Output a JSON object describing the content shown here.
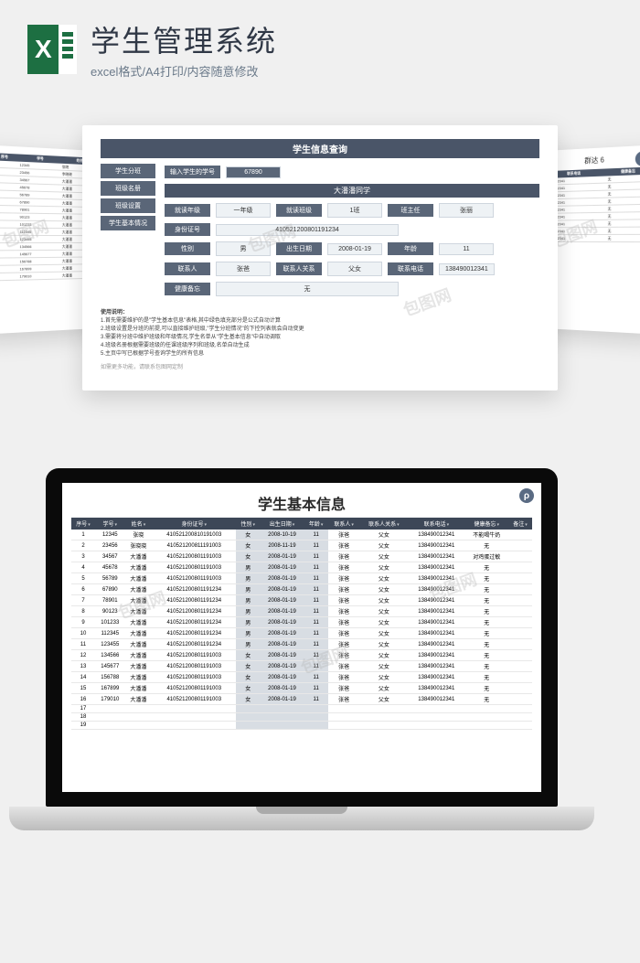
{
  "header": {
    "title": "学生管理系统",
    "subtitle": "excel格式/A4打印/内容随意修改",
    "icon_letter": "X"
  },
  "center_doc": {
    "title": "学生信息查询",
    "sidebar": [
      "学生分班",
      "班级名册",
      "班级设置",
      "学生基本情况"
    ],
    "input_label": "输入学生的学号",
    "input_value": "67890",
    "student_name": "大潘潘同学",
    "grade_label": "就读年级",
    "grade_value": "一年级",
    "class_label": "就读班级",
    "class_value": "1班",
    "teacher_label": "班主任",
    "teacher_value": "张丽",
    "id_label": "身份证号",
    "id_value": "410521200801191234",
    "gender_label": "性别",
    "gender_value": "男",
    "birth_label": "出生日期",
    "birth_value": "2008-01-19",
    "age_label": "年龄",
    "age_value": "11",
    "contact_label": "联系人",
    "contact_value": "张爸",
    "relation_label": "联系人关系",
    "relation_value": "父女",
    "phone_label": "联系电话",
    "phone_value": "138490012341",
    "health_label": "健康备忘",
    "health_value": "无",
    "notes_title": "使用说明：",
    "notes": [
      "1.首先需要维护的是\"学生基本信息\"表格,其中绿色填充部分是公式自动计算",
      "2.班级设置是分班的前提,可以直接维护班级,\"学生分班情况\"的下控列表就会自动变更",
      "3.需要将分班中维护班级和年级情况,学生名单从\"学生基本信息\"中自动调取",
      "4.班级名册根据需要班级的任课班级序列和班级,名单自动生成",
      "5.主页中写已根据学号查询学生的所有信息"
    ],
    "notes_footer": "如需更多功能，请联系包图网定制"
  },
  "right_doc": {
    "header1": "联系电话",
    "header2": "健康备忘",
    "group": "群达",
    "count": "6",
    "rows": [
      {
        "phone": "138490012341",
        "h": "无"
      },
      {
        "phone": "138490012341",
        "h": "无"
      },
      {
        "phone": "138490012341",
        "h": "无"
      },
      {
        "phone": "138490012341",
        "h": "无"
      },
      {
        "phone": "138490012341",
        "h": "无"
      },
      {
        "phone": "138490012341",
        "h": "无"
      },
      {
        "phone": "138490012341",
        "h": "无"
      },
      {
        "phone": "138490012341",
        "h": "无"
      },
      {
        "phone": "138490012341",
        "h": "无"
      }
    ]
  },
  "left_doc": {
    "headers": [
      "序号",
      "学号",
      "姓名"
    ],
    "rows": [
      {
        "i": "1",
        "id": "12345",
        "n": "张晓"
      },
      {
        "i": "2",
        "id": "23456",
        "n": "李晓晓"
      },
      {
        "i": "3",
        "id": "34567",
        "n": "大潘潘"
      },
      {
        "i": "4",
        "id": "45678",
        "n": "大潘潘"
      },
      {
        "i": "5",
        "id": "56789",
        "n": "大潘潘"
      },
      {
        "i": "6",
        "id": "67890",
        "n": "大潘潘"
      },
      {
        "i": "7",
        "id": "78901",
        "n": "大潘潘"
      },
      {
        "i": "8",
        "id": "90123",
        "n": "大潘潘"
      },
      {
        "i": "9",
        "id": "101233",
        "n": "大潘潘"
      },
      {
        "i": "10",
        "id": "112345",
        "n": "大潘潘"
      },
      {
        "i": "11",
        "id": "123455",
        "n": "大潘潘"
      },
      {
        "i": "12",
        "id": "134566",
        "n": "大潘潘"
      },
      {
        "i": "13",
        "id": "145677",
        "n": "大潘潘"
      },
      {
        "i": "14",
        "id": "156788",
        "n": "大潘潘"
      },
      {
        "i": "15",
        "id": "167899",
        "n": "大潘潘"
      },
      {
        "i": "16",
        "id": "179010",
        "n": "大潘潘"
      }
    ]
  },
  "screen": {
    "title": "学生基本信息",
    "headers": [
      "序号",
      "学号",
      "姓名",
      "身份证号",
      "性别",
      "出生日期",
      "年龄",
      "联系人",
      "联系人关系",
      "联系电话",
      "健康备忘",
      "备注"
    ],
    "rows": [
      {
        "i": "1",
        "id": "12345",
        "n": "张晓",
        "card": "410521200810191003",
        "g": "女",
        "b": "2008-10-19",
        "a": "11",
        "c": "张爸",
        "r": "父女",
        "p": "138490012341",
        "h": "不能喝牛奶",
        "note": ""
      },
      {
        "i": "2",
        "id": "23456",
        "n": "张晓晓",
        "card": "410521200811191003",
        "g": "女",
        "b": "2008-11-19",
        "a": "11",
        "c": "张爸",
        "r": "父女",
        "p": "138490012341",
        "h": "无",
        "note": ""
      },
      {
        "i": "3",
        "id": "34567",
        "n": "大潘潘",
        "card": "410521200801191003",
        "g": "女",
        "b": "2008-01-19",
        "a": "11",
        "c": "张爸",
        "r": "父女",
        "p": "138490012341",
        "h": "对鸡蛋过敏",
        "note": ""
      },
      {
        "i": "4",
        "id": "45678",
        "n": "大潘潘",
        "card": "410521200801191003",
        "g": "男",
        "b": "2008-01-19",
        "a": "11",
        "c": "张爸",
        "r": "父女",
        "p": "138490012341",
        "h": "无",
        "note": ""
      },
      {
        "i": "5",
        "id": "56789",
        "n": "大潘潘",
        "card": "410521200801191003",
        "g": "男",
        "b": "2008-01-19",
        "a": "11",
        "c": "张爸",
        "r": "父女",
        "p": "138490012341",
        "h": "无",
        "note": ""
      },
      {
        "i": "6",
        "id": "67890",
        "n": "大潘潘",
        "card": "410521200801191234",
        "g": "男",
        "b": "2008-01-19",
        "a": "11",
        "c": "张爸",
        "r": "父女",
        "p": "138490012341",
        "h": "无",
        "note": ""
      },
      {
        "i": "7",
        "id": "78901",
        "n": "大潘潘",
        "card": "410521200801191234",
        "g": "男",
        "b": "2008-01-19",
        "a": "11",
        "c": "张爸",
        "r": "父女",
        "p": "138490012341",
        "h": "无",
        "note": ""
      },
      {
        "i": "8",
        "id": "90123",
        "n": "大潘潘",
        "card": "410521200801191234",
        "g": "男",
        "b": "2008-01-19",
        "a": "11",
        "c": "张爸",
        "r": "父女",
        "p": "138490012341",
        "h": "无",
        "note": ""
      },
      {
        "i": "9",
        "id": "101233",
        "n": "大潘潘",
        "card": "410521200801191234",
        "g": "男",
        "b": "2008-01-19",
        "a": "11",
        "c": "张爸",
        "r": "父女",
        "p": "138490012341",
        "h": "无",
        "note": ""
      },
      {
        "i": "10",
        "id": "112345",
        "n": "大潘潘",
        "card": "410521200801191234",
        "g": "男",
        "b": "2008-01-19",
        "a": "11",
        "c": "张爸",
        "r": "父女",
        "p": "138490012341",
        "h": "无",
        "note": ""
      },
      {
        "i": "11",
        "id": "123455",
        "n": "大潘潘",
        "card": "410521200801191234",
        "g": "男",
        "b": "2008-01-19",
        "a": "11",
        "c": "张爸",
        "r": "父女",
        "p": "138490012341",
        "h": "无",
        "note": ""
      },
      {
        "i": "12",
        "id": "134566",
        "n": "大潘潘",
        "card": "410521200801191003",
        "g": "女",
        "b": "2008-01-19",
        "a": "11",
        "c": "张爸",
        "r": "父女",
        "p": "138490012341",
        "h": "无",
        "note": ""
      },
      {
        "i": "13",
        "id": "145677",
        "n": "大潘潘",
        "card": "410521200801191003",
        "g": "女",
        "b": "2008-01-19",
        "a": "11",
        "c": "张爸",
        "r": "父女",
        "p": "138490012341",
        "h": "无",
        "note": ""
      },
      {
        "i": "14",
        "id": "156788",
        "n": "大潘潘",
        "card": "410521200801191003",
        "g": "女",
        "b": "2008-01-19",
        "a": "11",
        "c": "张爸",
        "r": "父女",
        "p": "138490012341",
        "h": "无",
        "note": ""
      },
      {
        "i": "15",
        "id": "167899",
        "n": "大潘潘",
        "card": "410521200801191003",
        "g": "女",
        "b": "2008-01-19",
        "a": "11",
        "c": "张爸",
        "r": "父女",
        "p": "138490012341",
        "h": "无",
        "note": ""
      },
      {
        "i": "16",
        "id": "179010",
        "n": "大潘潘",
        "card": "410521200801191003",
        "g": "女",
        "b": "2008-01-19",
        "a": "11",
        "c": "张爸",
        "r": "父女",
        "p": "138490012341",
        "h": "无",
        "note": ""
      },
      {
        "i": "17",
        "id": "",
        "n": "",
        "card": "",
        "g": "",
        "b": "",
        "a": "",
        "c": "",
        "r": "",
        "p": "",
        "h": "",
        "note": ""
      },
      {
        "i": "18",
        "id": "",
        "n": "",
        "card": "",
        "g": "",
        "b": "",
        "a": "",
        "c": "",
        "r": "",
        "p": "",
        "h": "",
        "note": ""
      },
      {
        "i": "19",
        "id": "",
        "n": "",
        "card": "",
        "g": "",
        "b": "",
        "a": "",
        "c": "",
        "r": "",
        "p": "",
        "h": "",
        "note": ""
      }
    ]
  },
  "watermark": "包图网",
  "logo_letter": "ρ"
}
